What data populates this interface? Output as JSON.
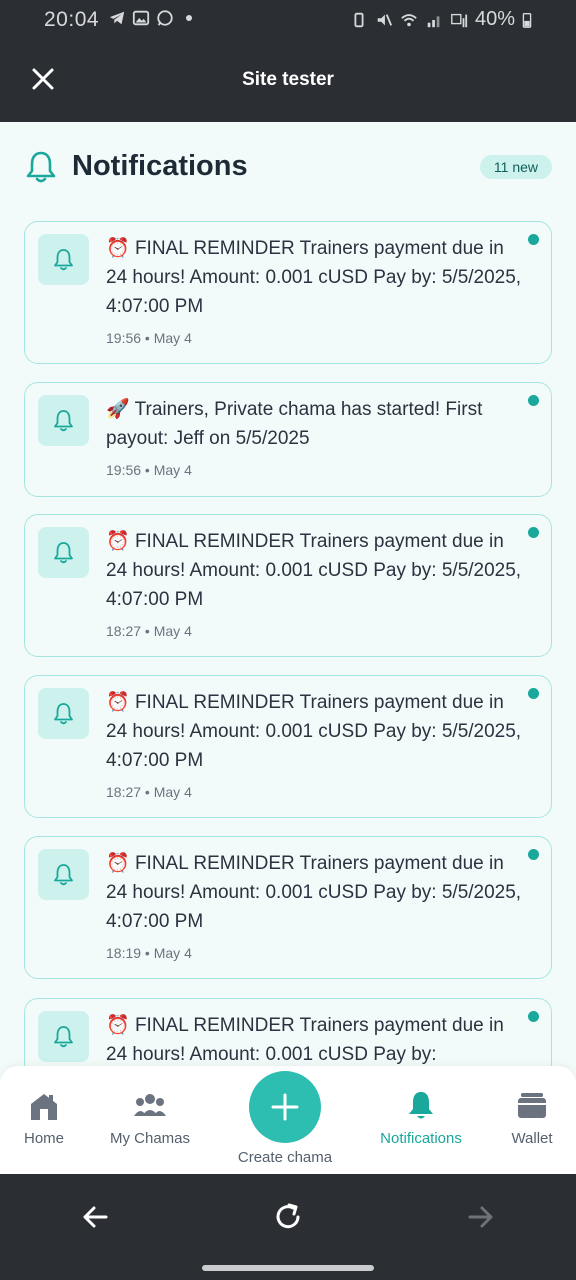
{
  "status_bar": {
    "time": "20:04",
    "battery": "40%"
  },
  "header": {
    "title": "Site tester"
  },
  "page": {
    "title": "Notifications",
    "new_badge": "11 new"
  },
  "notifications": [
    {
      "emoji": "⏰",
      "text": "FINAL REMINDER Trainers payment due in 24 hours! Amount: 0.001 cUSD Pay by: 5/5/2025, 4:07:00 PM",
      "time": "19:56",
      "date": "May 4"
    },
    {
      "emoji": "🚀",
      "text": "Trainers, Private chama has started! First payout: Jeff on 5/5/2025",
      "time": "19:56",
      "date": "May 4"
    },
    {
      "emoji": "⏰",
      "text": "FINAL REMINDER Trainers payment due in 24 hours! Amount: 0.001 cUSD Pay by: 5/5/2025, 4:07:00 PM",
      "time": "18:27",
      "date": "May 4"
    },
    {
      "emoji": "⏰",
      "text": "FINAL REMINDER Trainers payment due in 24 hours! Amount: 0.001 cUSD Pay by: 5/5/2025, 4:07:00 PM",
      "time": "18:27",
      "date": "May 4"
    },
    {
      "emoji": "⏰",
      "text": "FINAL REMINDER Trainers payment due in 24 hours! Amount: 0.001 cUSD Pay by: 5/5/2025, 4:07:00 PM",
      "time": "18:19",
      "date": "May 4"
    },
    {
      "emoji": "⏰",
      "text": "FINAL REMINDER Trainers payment due in 24 hours! Amount: 0.001 cUSD Pay by:",
      "time": "",
      "date": ""
    }
  ],
  "nav": {
    "home": "Home",
    "my_chamas": "My Chamas",
    "create": "Create chama",
    "notifications": "Notifications",
    "wallet": "Wallet"
  },
  "colors": {
    "accent": "#19a89b",
    "fab": "#2ebdb1",
    "card_border": "#a7e6df",
    "icon_bg": "#cdf1ec"
  }
}
